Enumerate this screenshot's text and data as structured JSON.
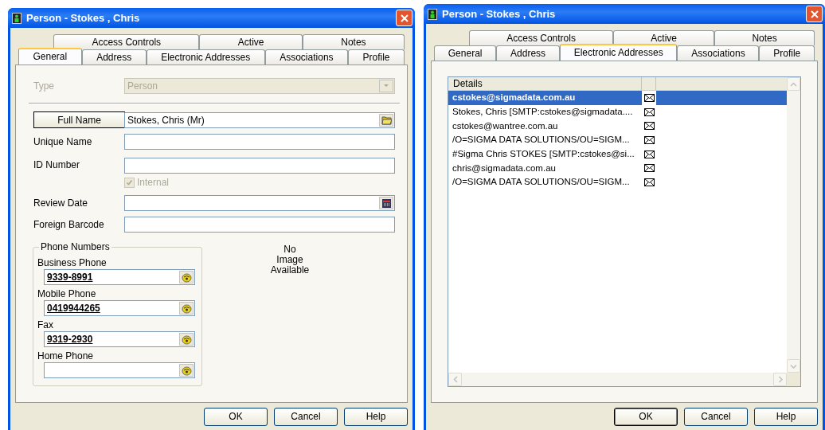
{
  "windows": [
    {
      "title": "Person - Stokes , Chris",
      "kind": "general",
      "tab_rows": [
        [
          {
            "label": "Access Controls",
            "selected": false
          },
          {
            "label": "Active",
            "selected": false
          },
          {
            "label": "Notes",
            "selected": false
          }
        ],
        [
          {
            "label": "General",
            "selected": true
          },
          {
            "label": "Address",
            "selected": false
          },
          {
            "label": "Electronic Addresses",
            "selected": false
          },
          {
            "label": "Associations",
            "selected": false
          },
          {
            "label": "Profile",
            "selected": false
          }
        ]
      ],
      "type": {
        "label": "Type",
        "value": "Person",
        "disabled": true
      },
      "fields": [
        {
          "kind": "lookup",
          "label": "Full Name",
          "value": "Stokes, Chris (Mr)"
        },
        {
          "kind": "text",
          "label": "Unique Name"
        },
        {
          "kind": "text",
          "label": "ID Number"
        },
        {
          "kind": "checkbox",
          "label": "Internal",
          "checked": true,
          "disabled": true
        },
        {
          "kind": "date",
          "label": "Review Date"
        },
        {
          "kind": "text",
          "label": "Foreign Barcode"
        }
      ],
      "phone_group": {
        "title": "Phone Numbers",
        "phones": [
          {
            "label": "Business Phone",
            "value": "9339-8991"
          },
          {
            "label": "Mobile Phone",
            "value": "0419944265"
          },
          {
            "label": "Fax",
            "value": "9319-2930"
          },
          {
            "label": "Home Phone"
          }
        ]
      },
      "image_text": "No Image Available",
      "buttons": [
        {
          "label": "OK",
          "default": false
        },
        {
          "label": "Cancel",
          "default": false
        },
        {
          "label": "Help",
          "default": false
        }
      ]
    },
    {
      "title": "Person - Stokes , Chris",
      "kind": "list",
      "tab_rows": [
        [
          {
            "label": "Access Controls",
            "selected": false
          },
          {
            "label": "Active",
            "selected": false
          },
          {
            "label": "Notes",
            "selected": false
          }
        ],
        [
          {
            "label": "General",
            "selected": false
          },
          {
            "label": "Address",
            "selected": false
          },
          {
            "label": "Electronic Addresses",
            "selected": true
          },
          {
            "label": "Associations",
            "selected": false
          },
          {
            "label": "Profile",
            "selected": false
          }
        ]
      ],
      "list": {
        "columns": [
          "Details"
        ],
        "rows": [
          {
            "text": "cstokes@sigmadata.com.au",
            "selected": true
          },
          {
            "text": "Stokes, Chris [SMTP:cstokes@sigmadata....",
            "selected": false
          },
          {
            "text": "cstokes@wantree.com.au",
            "selected": false
          },
          {
            "text": "/O=SIGMA DATA SOLUTIONS/OU=SIGM...",
            "selected": false
          },
          {
            "text": "#Sigma Chris STOKES [SMTP:cstokes@si...",
            "selected": false
          },
          {
            "text": "chris@sigmadata.com.au",
            "selected": false
          },
          {
            "text": "/O=SIGMA DATA SOLUTIONS/OU=SIGM...",
            "selected": false
          }
        ]
      },
      "buttons": [
        {
          "label": "OK",
          "default": true
        },
        {
          "label": "Cancel",
          "default": false
        },
        {
          "label": "Help",
          "default": false
        }
      ]
    }
  ]
}
